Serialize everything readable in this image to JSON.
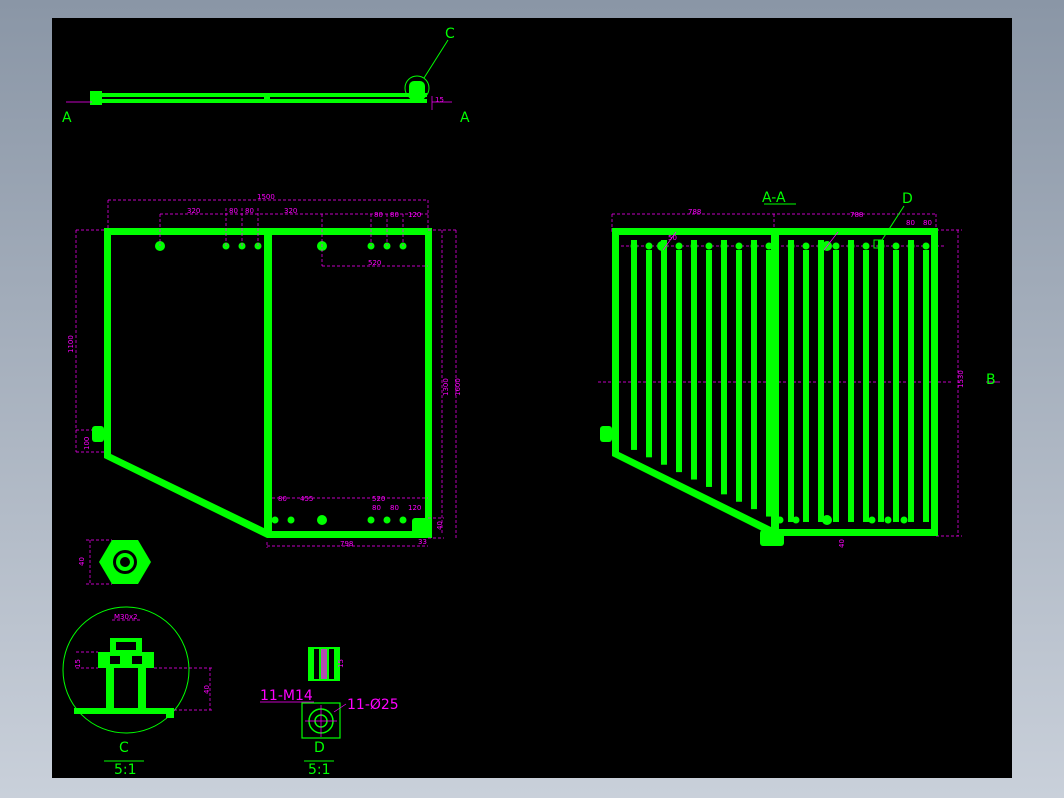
{
  "colors": {
    "background": "#000000",
    "geometry": "#00ff00",
    "dimensions": "#ff00ff"
  },
  "labels": {
    "section_a_left": "A",
    "section_a_right": "A",
    "detail_c_callout": "C",
    "section_aa_title": "A-A",
    "detail_d_callout": "D",
    "section_b": "B",
    "detail_c_title": "C",
    "detail_c_scale": "5:1",
    "detail_d_title": "D",
    "detail_d_scale": "5:1",
    "hole_spec_m14": "11-M14",
    "hole_spec_dia25": "11-Ø25",
    "thread_spec": "M30x2"
  },
  "dims": {
    "top_total": "1500",
    "top_320a": "320",
    "top_80a": "80",
    "top_80b": "80",
    "top_320b": "320",
    "top_80c": "80",
    "top_80d": "80",
    "top_120": "120",
    "mid_520": "520",
    "left_1100": "1100",
    "left_100": "100",
    "right_1300": "1300",
    "right_1600": "1600",
    "bot_80": "80",
    "bot_455": "455",
    "bot_520": "520",
    "bot_80b": "80",
    "bot_80c": "80",
    "bot_120": "120",
    "bot_798": "798",
    "bot_33": "33",
    "bot_40": "40",
    "aa_788a": "788",
    "aa_788b": "788",
    "aa_50": "50",
    "aa_80a": "80",
    "aa_80b": "80",
    "aa_1530": "1530",
    "aa_40": "40",
    "nut_40": "40",
    "c_15": "15",
    "c_40": "40",
    "d_15": "15",
    "top_15": "15"
  }
}
